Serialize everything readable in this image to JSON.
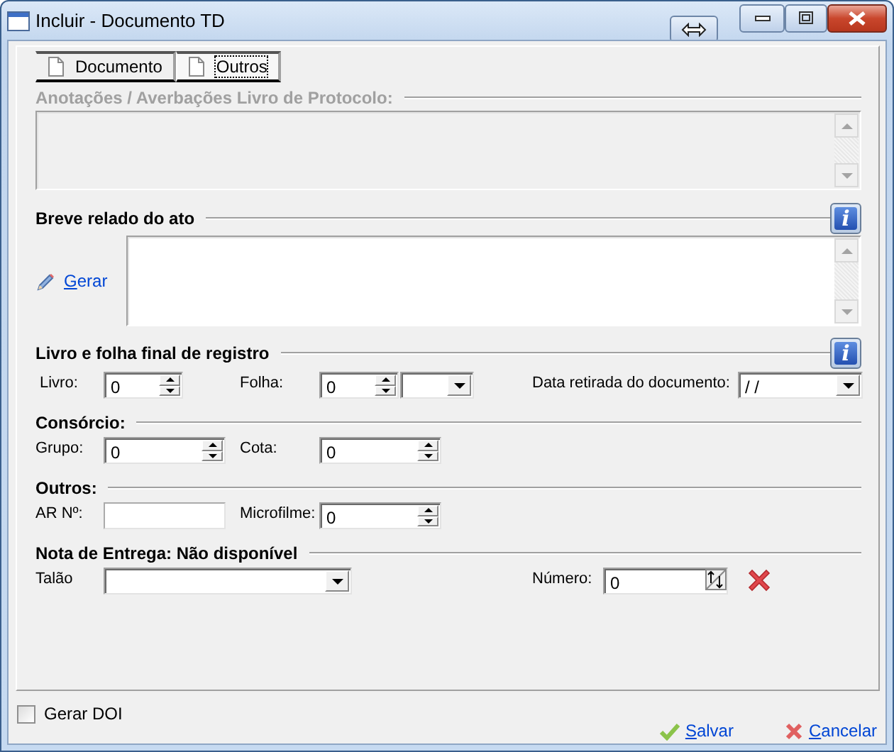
{
  "window": {
    "title": "Incluir - Documento TD"
  },
  "tabs": [
    {
      "label": "Documento",
      "selected": false
    },
    {
      "label": "Outros",
      "selected": true
    }
  ],
  "sections": [
    {
      "kind": "memo",
      "title": "Anotações / Averbações Livro de Protocolo:",
      "disabled": true
    },
    {
      "kind": "memo",
      "title": "Breve relado do ato",
      "info": "i",
      "link": "Gerar",
      "disabled": false
    },
    {
      "kind": "fields",
      "title": "Livro e folha final de registro",
      "info": "i",
      "fields": [
        {
          "kind": "spin",
          "label": "Livro:",
          "value": "0"
        },
        {
          "kind": "spin-combo",
          "label": "Folha:",
          "value": "0"
        },
        {
          "kind": "combo",
          "label": "Data retirada do documento:",
          "value": "/ /"
        }
      ]
    },
    {
      "kind": "fields",
      "title": "Consórcio:",
      "fields": [
        {
          "kind": "spin",
          "label": "Grupo:",
          "value": "0"
        },
        {
          "kind": "spin",
          "label": "Cota:",
          "value": "0"
        }
      ]
    },
    {
      "kind": "fields",
      "title": "Outros:",
      "fields": [
        {
          "kind": "text",
          "label": "AR Nº:"
        },
        {
          "kind": "spin",
          "label": "Microfilme:",
          "value": "0"
        }
      ]
    },
    {
      "kind": "fields",
      "title": "Nota de Entrega: Não disponível",
      "fields": [
        {
          "kind": "combo",
          "label": "Talão"
        },
        {
          "kind": "number",
          "label": "Número:",
          "value": "0"
        }
      ]
    }
  ],
  "footer": {
    "checkbox": {
      "label": "Gerar DOI",
      "checked": false
    },
    "buttons": [
      {
        "kind": "save",
        "label": "Salvar"
      },
      {
        "kind": "cancel",
        "label": "Cancelar"
      }
    ]
  }
}
